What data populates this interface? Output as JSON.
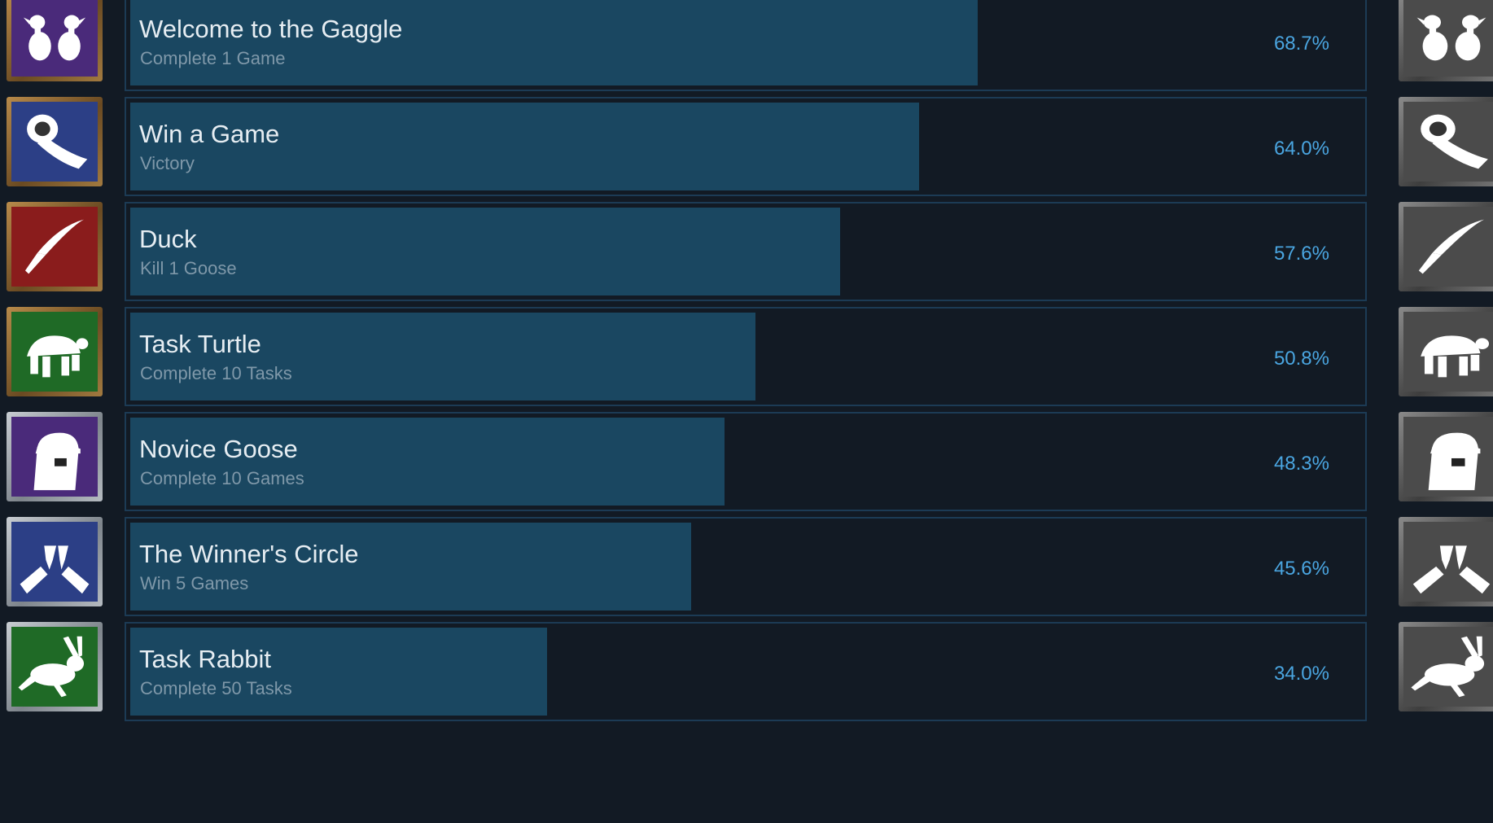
{
  "achievements": [
    {
      "title": "Welcome to the Gaggle",
      "description": "Complete 1 Game",
      "percent_text": "68.7%",
      "percent": 68.7,
      "icon": "goose-pair-icon",
      "bg": "#4a2a7a",
      "frame": "gold"
    },
    {
      "title": "Win a Game",
      "description": "Victory",
      "percent_text": "64.0%",
      "percent": 64.0,
      "icon": "ribbon-award-icon",
      "bg": "#2c3f86",
      "frame": "gold"
    },
    {
      "title": "Duck",
      "description": "Kill 1 Goose",
      "percent_text": "57.6%",
      "percent": 57.6,
      "icon": "knife-icon",
      "bg": "#8a1c1c",
      "frame": "gold"
    },
    {
      "title": "Task Turtle",
      "description": "Complete 10 Tasks",
      "percent_text": "50.8%",
      "percent": 50.8,
      "icon": "turtle-icon",
      "bg": "#1f6a26",
      "frame": "gold"
    },
    {
      "title": "Novice Goose",
      "description": "Complete 10 Games",
      "percent_text": "48.3%",
      "percent": 48.3,
      "icon": "goose-helmet-icon",
      "bg": "#4a2a7a",
      "frame": "silver"
    },
    {
      "title": "The Winner's Circle",
      "description": "Win 5 Games",
      "percent_text": "45.6%",
      "percent": 45.6,
      "icon": "toast-glasses-icon",
      "bg": "#2c3f86",
      "frame": "silver"
    },
    {
      "title": "Task Rabbit",
      "description": "Complete 50 Tasks",
      "percent_text": "34.0%",
      "percent": 34.0,
      "icon": "rabbit-icon",
      "bg": "#1f6a26",
      "frame": "silver"
    }
  ],
  "colors": {
    "bar_fill": "#1a4761",
    "bar_border": "#1c3b55",
    "percent_text": "#4aa5e0",
    "locked_icon_bg": "#4b4b4b"
  }
}
